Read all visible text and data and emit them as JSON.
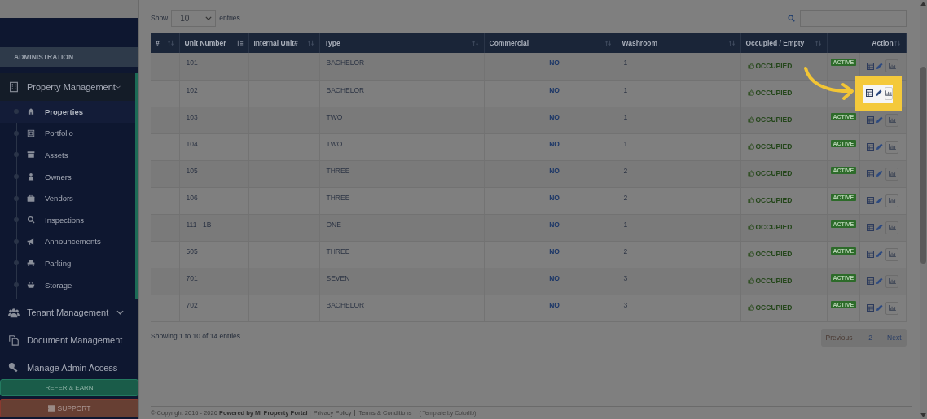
{
  "sidebar": {
    "section_title": "ADMINISTRATION",
    "items": [
      {
        "label": "Property Management",
        "expanded": true,
        "children": [
          {
            "label": "Properties",
            "selected": true
          },
          {
            "label": "Portfolio",
            "selected": false
          },
          {
            "label": "Assets",
            "selected": false
          },
          {
            "label": "Owners",
            "selected": false
          },
          {
            "label": "Vendors",
            "selected": false
          },
          {
            "label": "Inspections",
            "selected": false
          },
          {
            "label": "Announcements",
            "selected": false
          },
          {
            "label": "Parking",
            "selected": false
          },
          {
            "label": "Storage",
            "selected": false
          }
        ]
      },
      {
        "label": "Tenant Management",
        "expanded": false
      },
      {
        "label": "Document Management"
      },
      {
        "label": "Manage Admin Access"
      }
    ],
    "refer_button": "REFER & EARN",
    "support_button": "SUPPORT"
  },
  "table_controls": {
    "show_label": "Show",
    "page_length": "10",
    "entries_label": "entries"
  },
  "table": {
    "columns": [
      {
        "label": "#",
        "sorted": false
      },
      {
        "label": "Unit Number",
        "sorted": true
      },
      {
        "label": "Internal Unit#",
        "sorted": false
      },
      {
        "label": "Type",
        "sorted": false
      },
      {
        "label": "Commercial",
        "sorted": false
      },
      {
        "label": "Washroom",
        "sorted": false
      },
      {
        "label": "Occupied / Empty",
        "sorted": false
      },
      {
        "kind": "blank"
      },
      {
        "label": "Action",
        "sorted": false
      }
    ],
    "rows": [
      {
        "unit": "101",
        "type": "BACHELOR",
        "commercial": "NO",
        "washroom": "1",
        "occupancy": "OCCUPIED",
        "status": "ACTIVE",
        "highlighted": false
      },
      {
        "unit": "102",
        "type": "BACHELOR",
        "commercial": "NO",
        "washroom": "1",
        "occupancy": "OCCUPIED",
        "highlighted": true
      },
      {
        "unit": "103",
        "type": "TWO",
        "commercial": "NO",
        "washroom": "1",
        "occupancy": "OCCUPIED",
        "status": "ACTIVE",
        "highlighted": false
      },
      {
        "unit": "104",
        "type": "TWO",
        "commercial": "NO",
        "washroom": "1",
        "occupancy": "OCCUPIED",
        "status": "ACTIVE",
        "highlighted": false
      },
      {
        "unit": "105",
        "type": "THREE",
        "commercial": "NO",
        "washroom": "2",
        "occupancy": "OCCUPIED",
        "status": "ACTIVE",
        "highlighted": false
      },
      {
        "unit": "106",
        "type": "THREE",
        "commercial": "NO",
        "washroom": "2",
        "occupancy": "OCCUPIED",
        "status": "ACTIVE",
        "highlighted": false
      },
      {
        "unit": "111 - 1B",
        "type": "ONE",
        "commercial": "NO",
        "washroom": "1",
        "occupancy": "OCCUPIED",
        "status": "ACTIVE",
        "highlighted": false
      },
      {
        "unit": "505",
        "type": "THREE",
        "commercial": "NO",
        "washroom": "2",
        "occupancy": "OCCUPIED",
        "status": "ACTIVE",
        "highlighted": false
      },
      {
        "unit": "701",
        "type": "SEVEN",
        "commercial": "NO",
        "washroom": "3",
        "occupancy": "OCCUPIED",
        "status": "ACTIVE",
        "highlighted": false
      },
      {
        "unit": "702",
        "type": "BACHELOR",
        "commercial": "NO",
        "washroom": "3",
        "occupancy": "OCCUPIED",
        "status": "ACTIVE",
        "highlighted": false
      }
    ]
  },
  "table_info": "Showing 1 to 10 of 14 entries",
  "pagination": [
    {
      "label": "Previous",
      "disabled": true
    },
    {
      "label": "2",
      "disabled": false
    },
    {
      "label": "Next",
      "disabled": false
    }
  ],
  "footer": {
    "copyright": "© Copyright 2016 - 2026 **Powered by MI Property Portal** |",
    "links": [
      "Privacy Policy",
      "Terms & Conditions"
    ],
    "credit": "( Template by Colorlib)"
  }
}
